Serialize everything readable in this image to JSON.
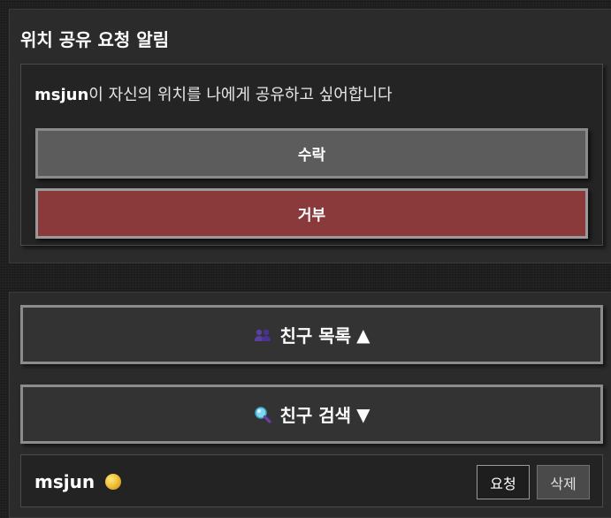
{
  "notification": {
    "title": "위치 공유 요청 알림",
    "request": {
      "user": "msjun",
      "message": "이 자신의 위치를 나에게 공유하고 싶어합니다",
      "accept_label": "수락",
      "reject_label": "거부"
    }
  },
  "friends": {
    "list_toggle": {
      "label": "친구 목록",
      "icon": "people-icon",
      "arrow": "▲"
    },
    "search_toggle": {
      "label": "친구 검색",
      "icon": "magnifier-icon",
      "arrow": "▼"
    },
    "items": [
      {
        "name": "msjun",
        "status_icon": "yellow-status-dot",
        "request_label": "요청",
        "delete_label": "삭제"
      }
    ]
  },
  "colors": {
    "reject_button": "#8b3a3c",
    "accept_button": "#5c5c5c",
    "status_dot": "#f2c33a"
  }
}
